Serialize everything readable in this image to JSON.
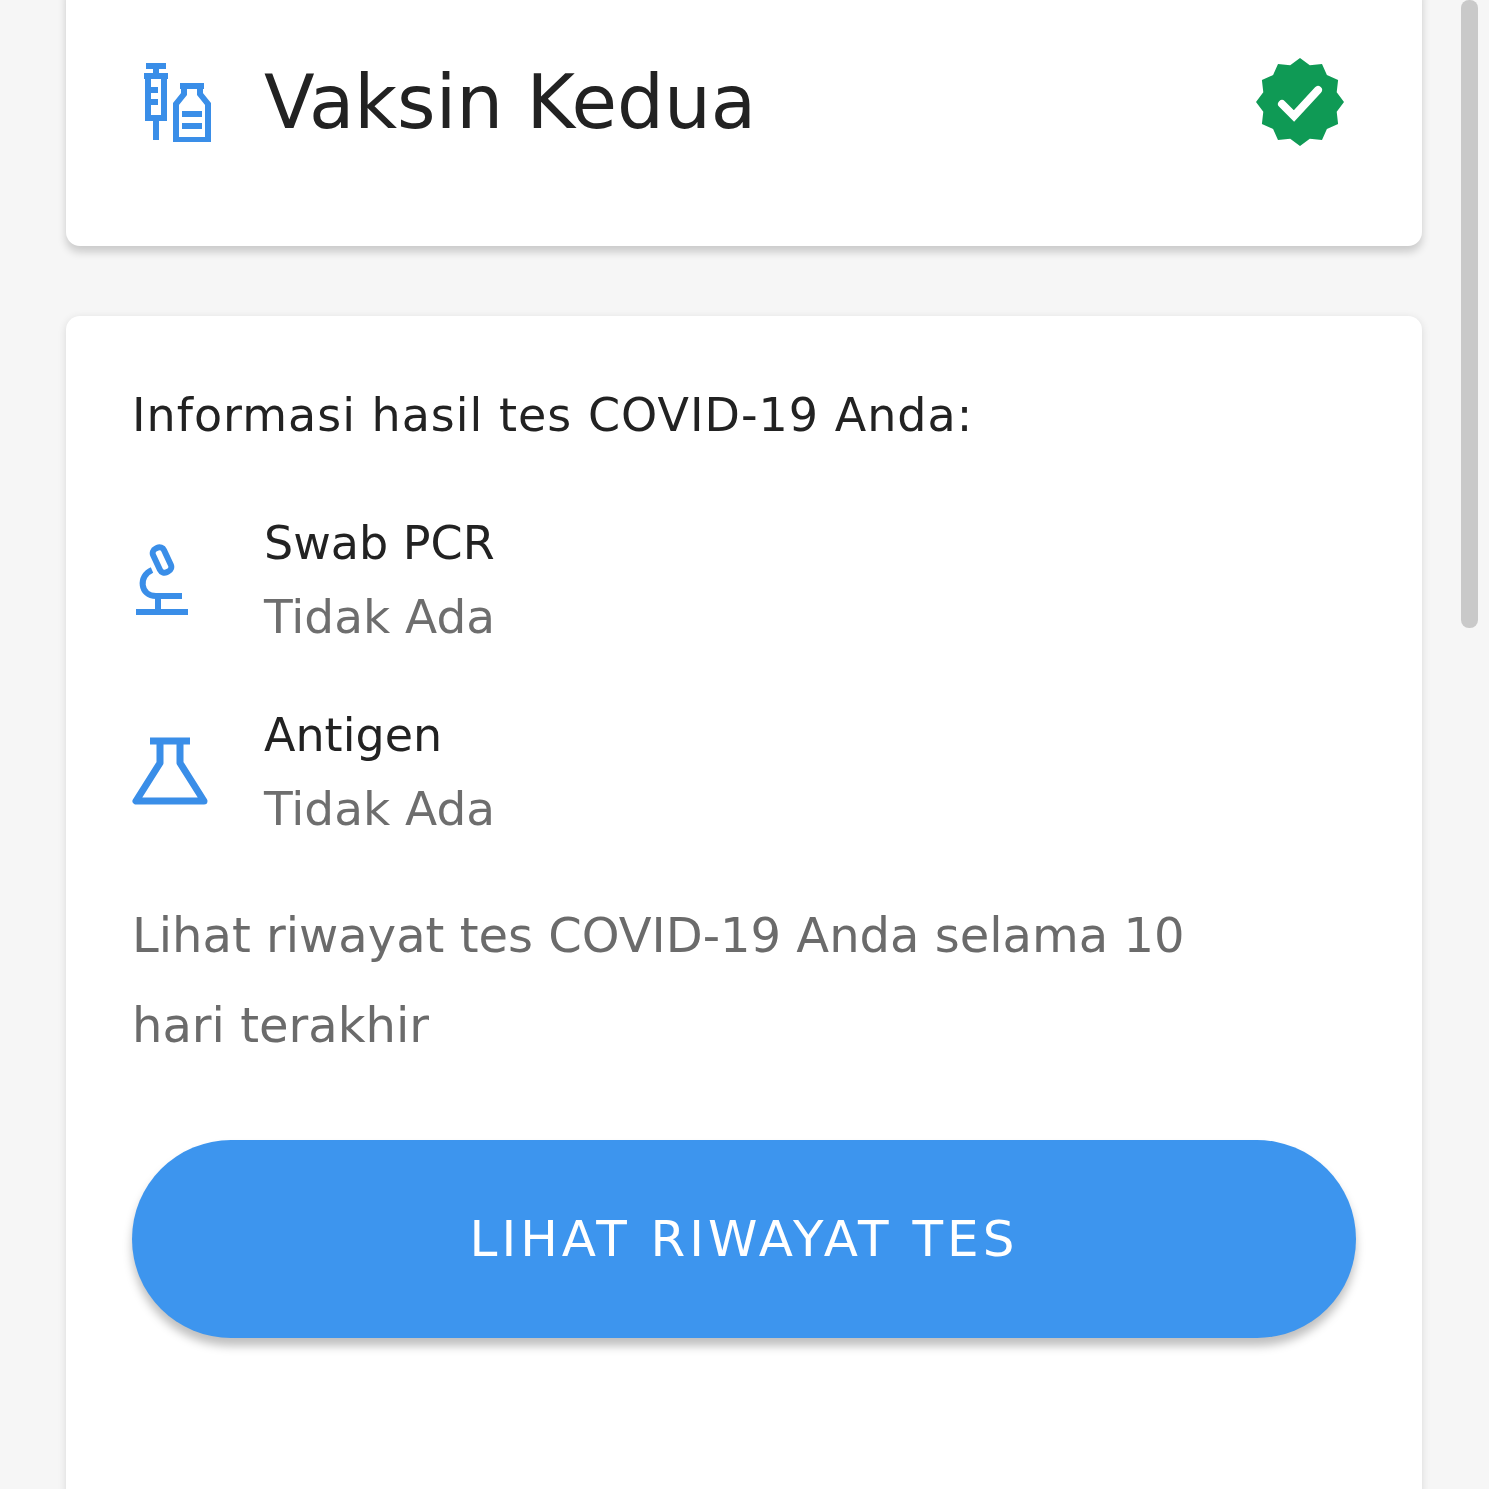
{
  "vaccine_card": {
    "title": "Vaksin Kedua",
    "verified": true
  },
  "test_info": {
    "heading": "Informasi hasil tes COVID-19 Anda:",
    "tests": [
      {
        "kind": "pcr",
        "name": "Swab PCR",
        "result": "Tidak Ada"
      },
      {
        "kind": "antigen",
        "name": "Antigen",
        "result": "Tidak Ada"
      }
    ],
    "note": "Lihat riwayat tes COVID-19 Anda selama 10 hari terakhir",
    "button": "LIHAT RIWAYAT TES"
  }
}
